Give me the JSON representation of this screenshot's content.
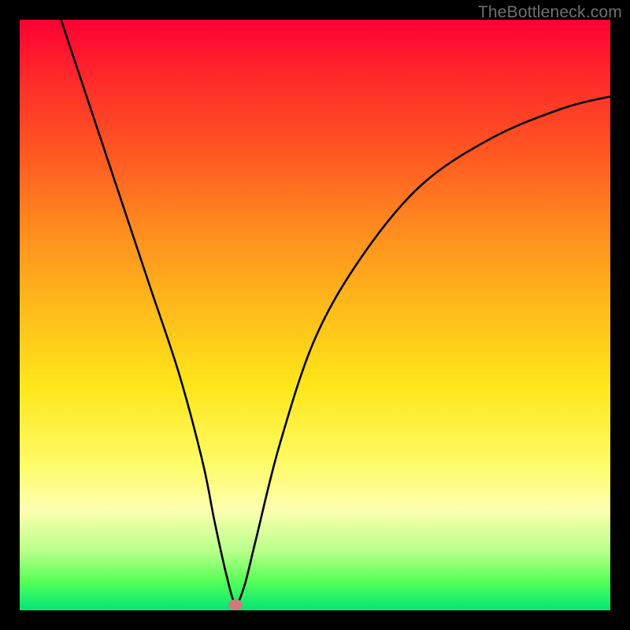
{
  "watermark": "TheBottleneck.com",
  "chart_data": {
    "type": "line",
    "title": "",
    "xlabel": "",
    "ylabel": "",
    "xlim": [
      0,
      100
    ],
    "ylim": [
      0,
      100
    ],
    "grid": false,
    "background": "rainbow-gradient red(top) to green(bottom)",
    "series": [
      {
        "name": "bottleneck-curve",
        "color": "#000000",
        "x": [
          7,
          12,
          17,
          22,
          27,
          31,
          33,
          35,
          36.5,
          38,
          40,
          44,
          50,
          58,
          68,
          80,
          92,
          100
        ],
        "values": [
          100,
          85,
          70,
          55,
          40,
          25,
          15,
          6,
          1.2,
          4,
          12,
          28,
          46,
          60,
          72,
          80,
          85,
          87
        ]
      }
    ],
    "marker": {
      "x": 36.5,
      "y": 1.0,
      "color": "#cf7b7b"
    }
  }
}
